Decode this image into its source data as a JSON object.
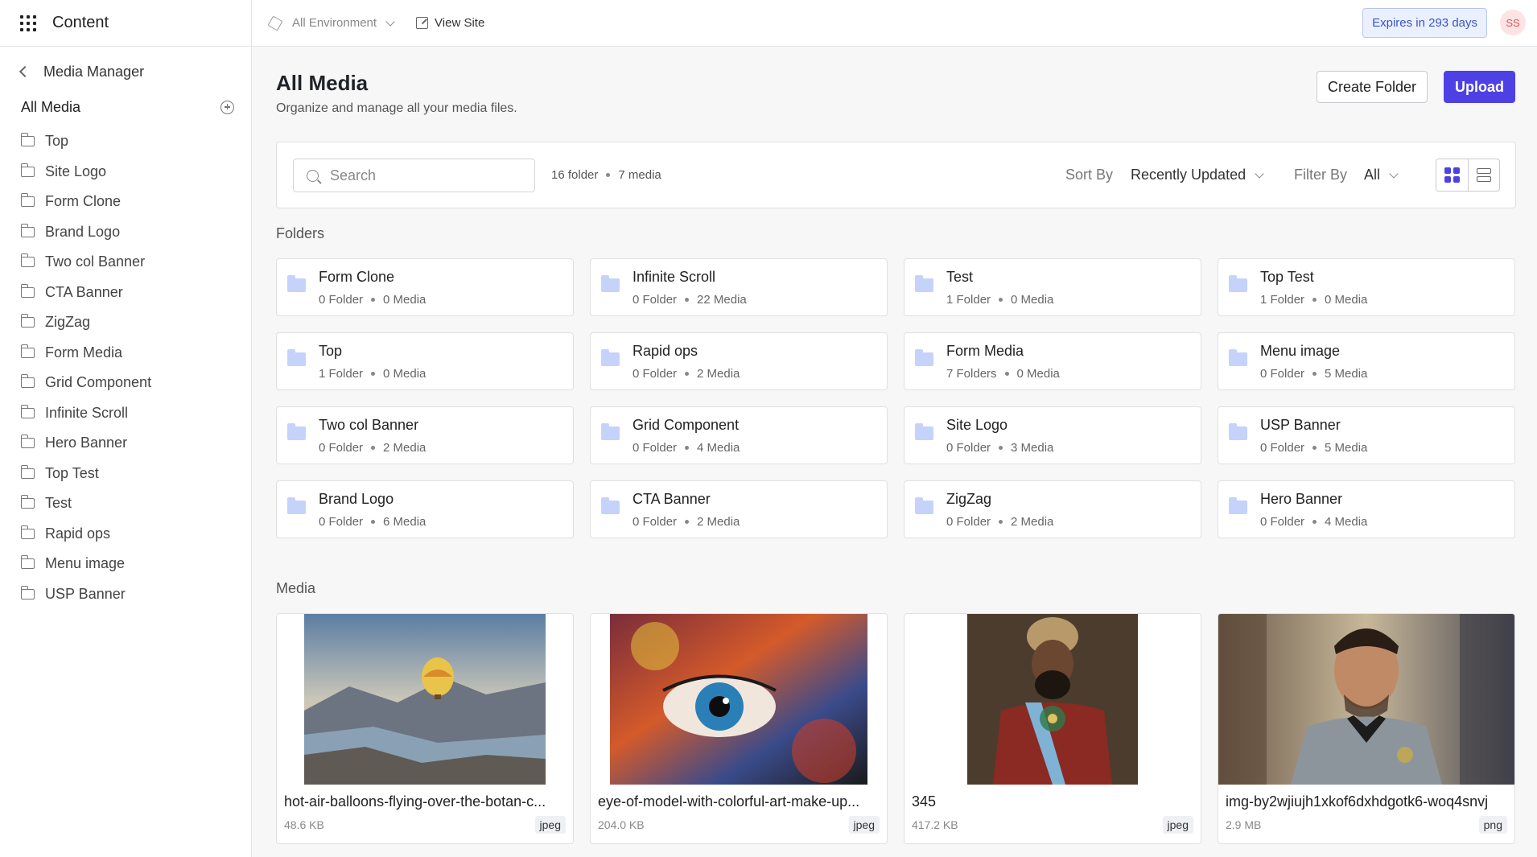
{
  "app": {
    "title": "Content"
  },
  "sidebar": {
    "back_label": "Media Manager",
    "all_media_label": "All Media",
    "folders": [
      "Top",
      "Site Logo",
      "Form Clone",
      "Brand Logo",
      "Two col Banner",
      "CTA Banner",
      "ZigZag",
      "Form Media",
      "Grid Component",
      "Infinite Scroll",
      "Hero Banner",
      "Top Test",
      "Test",
      "Rapid ops",
      "Menu image",
      "USP Banner"
    ]
  },
  "topbar": {
    "environment": "All Environment",
    "view_site": "View Site",
    "expires": "Expires in 293 days",
    "avatar_initials": "SS"
  },
  "page": {
    "title": "All Media",
    "subtitle": "Organize and manage all your media files.",
    "create_folder": "Create Folder",
    "upload": "Upload"
  },
  "toolbar": {
    "search_placeholder": "Search",
    "folder_count": "16 folder",
    "media_count": "7 media",
    "sort_label": "Sort By",
    "sort_value": "Recently Updated",
    "filter_label": "Filter By",
    "filter_value": "All"
  },
  "sections": {
    "folders": "Folders",
    "media": "Media"
  },
  "folder_cards": [
    {
      "name": "Form Clone",
      "folders": "0 Folder",
      "media": "0 Media"
    },
    {
      "name": "Infinite Scroll",
      "folders": "0 Folder",
      "media": "22 Media"
    },
    {
      "name": "Test",
      "folders": "1 Folder",
      "media": "0 Media"
    },
    {
      "name": "Top Test",
      "folders": "1 Folder",
      "media": "0 Media"
    },
    {
      "name": "Top",
      "folders": "1 Folder",
      "media": "0 Media"
    },
    {
      "name": "Rapid ops",
      "folders": "0 Folder",
      "media": "2 Media"
    },
    {
      "name": "Form Media",
      "folders": "7 Folders",
      "media": "0 Media"
    },
    {
      "name": "Menu image",
      "folders": "0 Folder",
      "media": "5 Media"
    },
    {
      "name": "Two col Banner",
      "folders": "0 Folder",
      "media": "2 Media"
    },
    {
      "name": "Grid Component",
      "folders": "0 Folder",
      "media": "4 Media"
    },
    {
      "name": "Site Logo",
      "folders": "0 Folder",
      "media": "3 Media"
    },
    {
      "name": "USP Banner",
      "folders": "0 Folder",
      "media": "5 Media"
    },
    {
      "name": "Brand Logo",
      "folders": "0 Folder",
      "media": "6 Media"
    },
    {
      "name": "CTA Banner",
      "folders": "0 Folder",
      "media": "2 Media"
    },
    {
      "name": "ZigZag",
      "folders": "0 Folder",
      "media": "2 Media"
    },
    {
      "name": "Hero Banner",
      "folders": "0 Folder",
      "media": "4 Media"
    }
  ],
  "media_cards": [
    {
      "name": "hot-air-balloons-flying-over-the-botan-c...",
      "size": "48.6 KB",
      "type": "jpeg"
    },
    {
      "name": "eye-of-model-with-colorful-art-make-up...",
      "size": "204.0 KB",
      "type": "jpeg"
    },
    {
      "name": "345",
      "size": "417.2 KB",
      "type": "jpeg"
    },
    {
      "name": "img-by2wjiujh1xkof6dxhdgotk6-woq4snvj",
      "size": "2.9 MB",
      "type": "png"
    }
  ],
  "colors": {
    "accent": "#4d41e6",
    "folder_icon": "#c5d3fb",
    "expires_bg": "#eaf0fd"
  }
}
